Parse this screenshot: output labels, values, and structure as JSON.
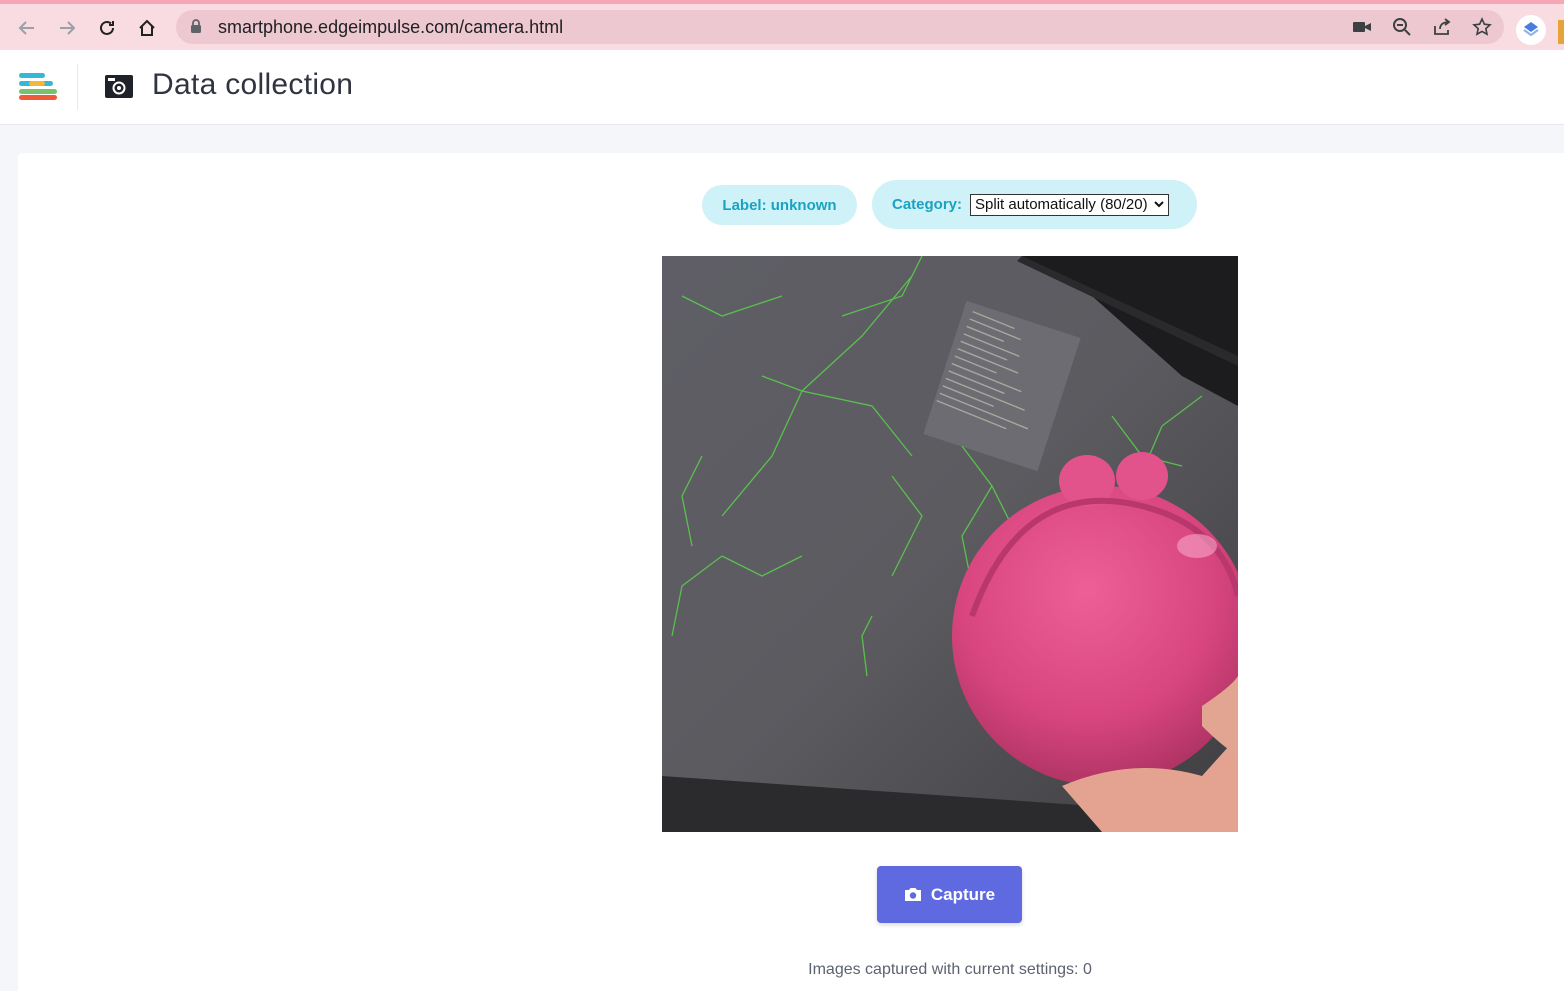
{
  "browser": {
    "url": "smartphone.edgeimpulse.com/camera.html",
    "nav_icons": [
      "back-arrow-icon",
      "forward-arrow-icon",
      "reload-icon",
      "home-icon"
    ],
    "omnibox_icons": [
      "lock-icon",
      "camera-permission-icon",
      "zoom-icon",
      "share-icon",
      "bookmark-star-icon"
    ],
    "extension_icon": "extension-icon"
  },
  "header": {
    "title": "Data collection",
    "logo_icon": "edge-impulse-logo-icon",
    "page_icon": "camera-icon"
  },
  "controls": {
    "label_text": "Label: unknown",
    "category_label": "Category:",
    "category_value": "Split automatically (80/20)"
  },
  "preview": {
    "description_icon": "camera-preview"
  },
  "capture": {
    "button_label": "Capture",
    "count_text": "Images captured with current settings: 0"
  },
  "colors": {
    "browser_bar": "#f9dbe2",
    "omnibox": "#eec8d1",
    "pill_bg": "#cff1f8",
    "pill_text": "#1aa3c1",
    "capture_button": "#5f6ae0",
    "page_bg": "#f5f6fa"
  }
}
